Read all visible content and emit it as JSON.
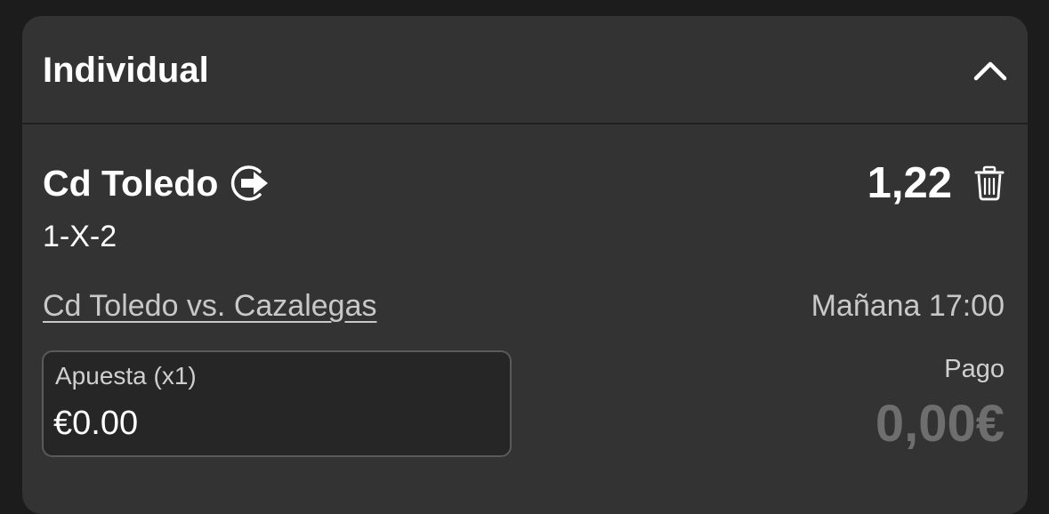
{
  "bet_slip": {
    "header": {
      "title": "Individual",
      "collapse_icon": "chevron-up-icon"
    },
    "selection": {
      "name": "Cd Toledo",
      "share_icon": "share-arrow-icon",
      "odds": "1,22",
      "remove_icon": "trash-icon",
      "market": "1-X-2",
      "event": "Cd Toledo vs. Cazalegas",
      "start_time": "Mañana 17:00"
    },
    "stake": {
      "label": "Apuesta (x1)",
      "value": "€0.00"
    },
    "payout": {
      "label": "Pago",
      "value": "0,00€"
    }
  },
  "colors": {
    "background": "#1c1c1c",
    "card": "#333333",
    "text_primary": "#ffffff",
    "text_secondary": "#c8c8c8",
    "payout_muted": "#6e6e6e"
  }
}
